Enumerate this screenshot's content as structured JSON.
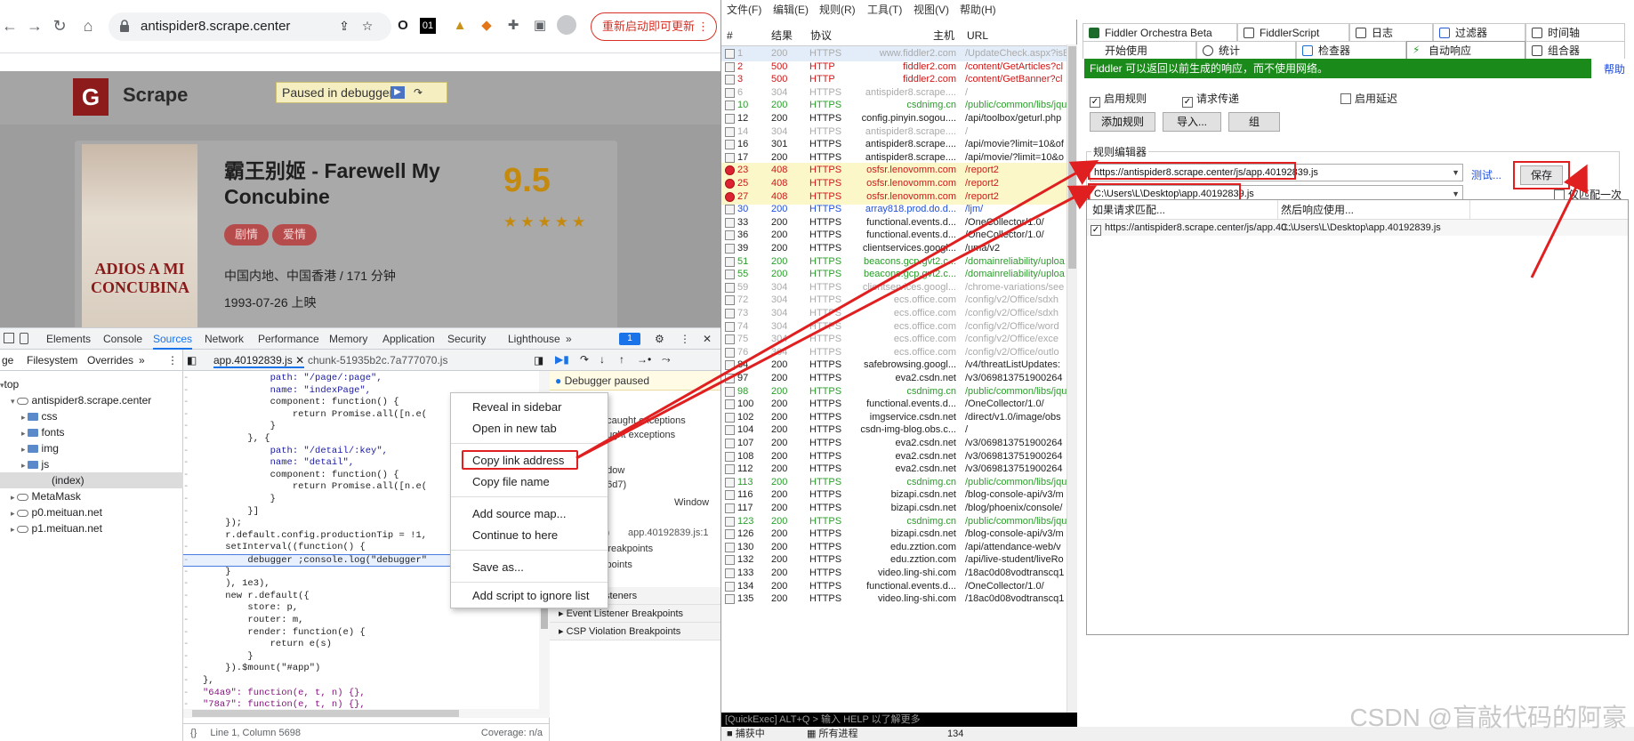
{
  "browser": {
    "url": "antispider8.scrape.center",
    "update_button": "重新启动即可更新",
    "ext_icons": [
      "O",
      "01"
    ]
  },
  "site": {
    "logo_letter": "G",
    "name": "Scrape",
    "paused_label": "Paused in debugger",
    "movie": {
      "title": "霸王别姬 - Farewell My Concubine",
      "poster_text": "ADIOS A MI CONCUBINA",
      "tags": [
        "剧情",
        "爱情"
      ],
      "region": "中国内地、中国香港 / 171 分钟",
      "date": "1993-07-26 上映",
      "score": "9.5",
      "stars": "★★★★★"
    }
  },
  "devtools": {
    "tabs": [
      "Elements",
      "Console",
      "Sources",
      "Network",
      "Performance",
      "Memory",
      "Application",
      "Security",
      "Lighthouse"
    ],
    "issues_badge": "1",
    "left_tabs": [
      "ge",
      "Filesystem",
      "Overrides"
    ],
    "tree": [
      {
        "label": "top",
        "indent": 0,
        "type": "frame"
      },
      {
        "label": "antispider8.scrape.center",
        "indent": 1,
        "type": "cloud"
      },
      {
        "label": "css",
        "indent": 2,
        "type": "folder"
      },
      {
        "label": "fonts",
        "indent": 2,
        "type": "folder"
      },
      {
        "label": "img",
        "indent": 2,
        "type": "folder"
      },
      {
        "label": "js",
        "indent": 2,
        "type": "folder"
      },
      {
        "label": "(index)",
        "indent": 3,
        "type": "file"
      },
      {
        "label": "MetaMask",
        "indent": 1,
        "type": "cloud"
      },
      {
        "label": "p0.meituan.net",
        "indent": 1,
        "type": "cloud"
      },
      {
        "label": "p1.meituan.net",
        "indent": 1,
        "type": "cloud"
      }
    ],
    "file_tabs": [
      "app.40192839.js",
      "chunk-51935b2c.7a777070.js"
    ],
    "code_lines": [
      "            path: \"/page/:page\",",
      "            name: \"indexPage\",",
      "            component: function() {",
      "                return Promise.all([n.e(",
      "            }",
      "        }, {",
      "            path: \"/detail/:key\",",
      "            name: \"detail\",",
      "            component: function() {",
      "                return Promise.all([n.e(",
      "            }",
      "        }]",
      "    });",
      "    r.default.config.productionTip = !1,",
      "    setInterval((function() {",
      "        debugger ;console.log(\"debugger\"",
      "    }",
      "    ), 1e3),",
      "    new r.default({",
      "        store: p,",
      "        router: m,",
      "        render: function(e) {",
      "            return e(s)",
      "        }",
      "    }).$mount(\"#app\")",
      "},",
      "\"64a9\": function(e, t, n) {},",
      "\"78a7\": function(e, t, n) {},",
      "\"7d32\": function(e, t, n) {},",
      "cf05: function(e, t, n) {"
    ],
    "status_line": "Line 1, Column 5698",
    "coverage": "Coverage: n/a",
    "debugger_paused": "Debugger paused",
    "right_fragments": [
      "s",
      "ncaught exceptions",
      "aught exceptions",
      "ndow",
      "56d7)",
      "Window",
      "s)",
      "app.40192839.js:1",
      "Breakpoints",
      "kpoints"
    ],
    "right_sections": [
      "Global Listeners",
      "Event Listener Breakpoints",
      "CSP Violation Breakpoints"
    ],
    "context_menu": [
      "Reveal in sidebar",
      "Open in new tab",
      "Copy link address",
      "Copy file name",
      "Add source map...",
      "Continue to here",
      "Save as...",
      "Add script to ignore list"
    ]
  },
  "fiddler": {
    "menu": [
      "文件(F)",
      "编辑(E)",
      "规则(R)",
      "工具(T)",
      "视图(V)",
      "帮助(H)"
    ],
    "columns": [
      "#",
      "结果",
      "协议",
      "主机",
      "URL"
    ],
    "sessions": [
      {
        "id": "1",
        "res": "200",
        "proto": "HTTPS",
        "host": "www.fiddler2.com",
        "url": "/UpdateCheck.aspx?isB",
        "style": "grey"
      },
      {
        "id": "2",
        "res": "500",
        "proto": "HTTP",
        "host": "fiddler2.com",
        "url": "/content/GetArticles?cl",
        "style": "red"
      },
      {
        "id": "3",
        "res": "500",
        "proto": "HTTP",
        "host": "fiddler2.com",
        "url": "/content/GetBanner?cl",
        "style": "red"
      },
      {
        "id": "6",
        "res": "304",
        "proto": "HTTPS",
        "host": "antispider8.scrape....",
        "url": "/",
        "style": "grey"
      },
      {
        "id": "10",
        "res": "200",
        "proto": "HTTPS",
        "host": "csdnimg.cn",
        "url": "/public/common/libs/jqu",
        "style": "green"
      },
      {
        "id": "12",
        "res": "200",
        "proto": "HTTPS",
        "host": "config.pinyin.sogou....",
        "url": "/api/toolbox/geturl.php",
        "style": "normal"
      },
      {
        "id": "14",
        "res": "304",
        "proto": "HTTPS",
        "host": "antispider8.scrape....",
        "url": "/",
        "style": "grey"
      },
      {
        "id": "16",
        "res": "301",
        "proto": "HTTPS",
        "host": "antispider8.scrape....",
        "url": "/api/movie?limit=10&of",
        "style": "normal"
      },
      {
        "id": "17",
        "res": "200",
        "proto": "HTTPS",
        "host": "antispider8.scrape....",
        "url": "/api/movie/?limit=10&o",
        "style": "normal"
      },
      {
        "id": "23",
        "res": "408",
        "proto": "HTTPS",
        "host": "osfsr.lenovomm.com",
        "url": "/report2",
        "style": "red"
      },
      {
        "id": "25",
        "res": "408",
        "proto": "HTTPS",
        "host": "osfsr.lenovomm.com",
        "url": "/report2",
        "style": "red"
      },
      {
        "id": "27",
        "res": "408",
        "proto": "HTTPS",
        "host": "osfsr.lenovomm.com",
        "url": "/report2",
        "style": "red"
      },
      {
        "id": "30",
        "res": "200",
        "proto": "HTTPS",
        "host": "array818.prod.do.d...",
        "url": "/ljm/",
        "style": "blue"
      },
      {
        "id": "33",
        "res": "200",
        "proto": "HTTPS",
        "host": "functional.events.d...",
        "url": "/OneCollector/1.0/",
        "style": "normal"
      },
      {
        "id": "36",
        "res": "200",
        "proto": "HTTPS",
        "host": "functional.events.d...",
        "url": "/OneCollector/1.0/",
        "style": "normal"
      },
      {
        "id": "39",
        "res": "200",
        "proto": "HTTPS",
        "host": "clientservices.googl...",
        "url": "/uma/v2",
        "style": "normal"
      },
      {
        "id": "51",
        "res": "200",
        "proto": "HTTPS",
        "host": "beacons.gcp.gvt2.c...",
        "url": "/domainreliability/uploa",
        "style": "green"
      },
      {
        "id": "55",
        "res": "200",
        "proto": "HTTPS",
        "host": "beacons.gcp.gvt2.c...",
        "url": "/domainreliability/uploa",
        "style": "green"
      },
      {
        "id": "59",
        "res": "304",
        "proto": "HTTPS",
        "host": "clientservices.googl...",
        "url": "/chrome-variations/see",
        "style": "grey"
      },
      {
        "id": "72",
        "res": "304",
        "proto": "HTTPS",
        "host": "ecs.office.com",
        "url": "/config/v2/Office/sdxh",
        "style": "grey"
      },
      {
        "id": "73",
        "res": "304",
        "proto": "HTTPS",
        "host": "ecs.office.com",
        "url": "/config/v2/Office/sdxh",
        "style": "grey"
      },
      {
        "id": "74",
        "res": "304",
        "proto": "HTTPS",
        "host": "ecs.office.com",
        "url": "/config/v2/Office/word",
        "style": "grey"
      },
      {
        "id": "75",
        "res": "304",
        "proto": "HTTPS",
        "host": "ecs.office.com",
        "url": "/config/v2/Office/exce",
        "style": "grey"
      },
      {
        "id": "76",
        "res": "304",
        "proto": "HTTPS",
        "host": "ecs.office.com",
        "url": "/config/v2/Office/outlo",
        "style": "grey"
      },
      {
        "id": "84",
        "res": "200",
        "proto": "HTTPS",
        "host": "safebrowsing.googl...",
        "url": "/v4/threatListUpdates:",
        "style": "normal"
      },
      {
        "id": "97",
        "res": "200",
        "proto": "HTTPS",
        "host": "eva2.csdn.net",
        "url": "/v3/069813751900264",
        "style": "normal"
      },
      {
        "id": "98",
        "res": "200",
        "proto": "HTTPS",
        "host": "csdnimg.cn",
        "url": "/public/common/libs/jqu",
        "style": "green"
      },
      {
        "id": "100",
        "res": "200",
        "proto": "HTTPS",
        "host": "functional.events.d...",
        "url": "/OneCollector/1.0/",
        "style": "normal"
      },
      {
        "id": "102",
        "res": "200",
        "proto": "HTTPS",
        "host": "imgservice.csdn.net",
        "url": "/direct/v1.0/image/obs",
        "style": "normal"
      },
      {
        "id": "104",
        "res": "200",
        "proto": "HTTPS",
        "host": "csdn-img-blog.obs.c...",
        "url": "/",
        "style": "normal"
      },
      {
        "id": "107",
        "res": "200",
        "proto": "HTTPS",
        "host": "eva2.csdn.net",
        "url": "/v3/069813751900264",
        "style": "normal"
      },
      {
        "id": "108",
        "res": "200",
        "proto": "HTTPS",
        "host": "eva2.csdn.net",
        "url": "/v3/069813751900264",
        "style": "normal"
      },
      {
        "id": "112",
        "res": "200",
        "proto": "HTTPS",
        "host": "eva2.csdn.net",
        "url": "/v3/069813751900264",
        "style": "normal"
      },
      {
        "id": "113",
        "res": "200",
        "proto": "HTTPS",
        "host": "csdnimg.cn",
        "url": "/public/common/libs/jqu",
        "style": "green"
      },
      {
        "id": "116",
        "res": "200",
        "proto": "HTTPS",
        "host": "bizapi.csdn.net",
        "url": "/blog-console-api/v3/m",
        "style": "normal"
      },
      {
        "id": "117",
        "res": "200",
        "proto": "HTTPS",
        "host": "bizapi.csdn.net",
        "url": "/blog/phoenix/console/",
        "style": "normal"
      },
      {
        "id": "123",
        "res": "200",
        "proto": "HTTPS",
        "host": "csdnimg.cn",
        "url": "/public/common/libs/jqu",
        "style": "green"
      },
      {
        "id": "126",
        "res": "200",
        "proto": "HTTPS",
        "host": "bizapi.csdn.net",
        "url": "/blog-console-api/v3/m",
        "style": "normal"
      },
      {
        "id": "130",
        "res": "200",
        "proto": "HTTPS",
        "host": "edu.zztion.com",
        "url": "/api/attendance-web/v",
        "style": "normal"
      },
      {
        "id": "132",
        "res": "200",
        "proto": "HTTPS",
        "host": "edu.zztion.com",
        "url": "/api/live-student/liveRo",
        "style": "normal"
      },
      {
        "id": "133",
        "res": "200",
        "proto": "HTTPS",
        "host": "video.ling-shi.com",
        "url": "/18ac0d08vodtranscq1",
        "style": "normal"
      },
      {
        "id": "134",
        "res": "200",
        "proto": "HTTPS",
        "host": "functional.events.d...",
        "url": "/OneCollector/1.0/",
        "style": "normal"
      },
      {
        "id": "135",
        "res": "200",
        "proto": "HTTPS",
        "host": "video.ling-shi.com",
        "url": "/18ac0d08vodtranscq1",
        "style": "normal"
      }
    ],
    "quickexec": "[QuickExec] ALT+Q > 输入 HELP 以了解更多",
    "status": {
      "capturing": "捕获中",
      "process": "所有进程",
      "count": "134"
    },
    "tabs_row1": [
      "Fiddler Orchestra Beta",
      "FiddlerScript",
      "日志",
      "过滤器",
      "时间轴"
    ],
    "tabs_row2": [
      "开始使用",
      "统计",
      "检查器",
      "自动响应",
      "组合器"
    ],
    "autoresp": {
      "info": "Fiddler 可以返回以前生成的响应，而不使用网络。",
      "help": "帮助",
      "enable_rules": "启用规则",
      "passthrough": "请求传递",
      "enable_latency": "启用延迟",
      "add_rule": "添加规则",
      "import": "导入...",
      "group": "组",
      "rule_editor": "规则编辑器",
      "match_value": "https://antispider8.scrape.center/js/app.40192839.js",
      "action_value": "C:\\Users\\L\\Desktop\\app.40192839.js",
      "test": "测试...",
      "save": "保存",
      "match_once": "仅匹配一次",
      "col_if": "如果请求匹配...",
      "col_then": "然后响应使用...",
      "rule_match": "https://antispider8.scrape.center/js/app.40...",
      "rule_action": "C:\\Users\\L\\Desktop\\app.40192839.js"
    }
  },
  "watermark": "CSDN @盲敲代码的阿豪",
  "colors": {
    "accent_red": "#e02020",
    "fiddler_green": "#1a8a1a",
    "score_gold": "#c48a10"
  }
}
